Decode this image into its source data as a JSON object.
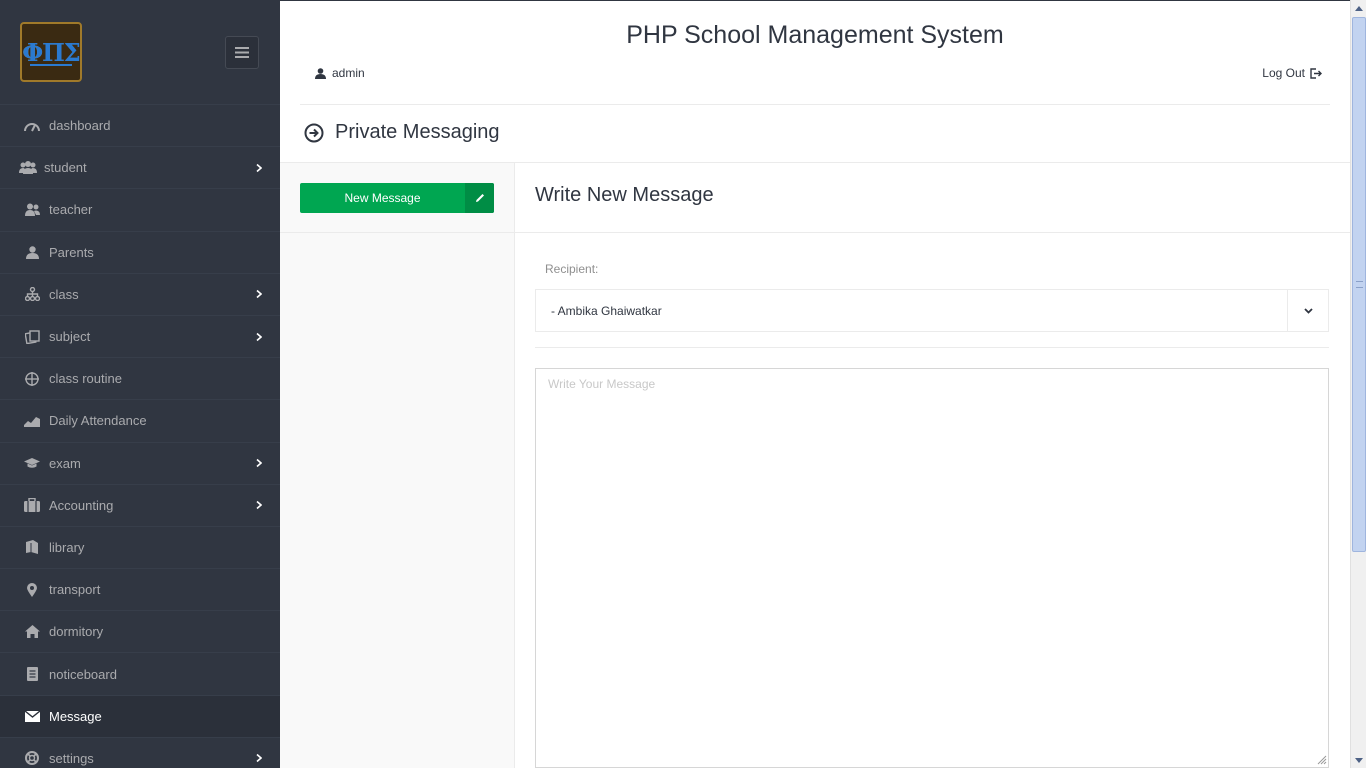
{
  "app": {
    "title": "PHP School Management System",
    "logo_text": "ΦΠΣ",
    "user": "admin",
    "logout_label": "Log Out"
  },
  "sidebar": {
    "items": [
      {
        "label": "dashboard",
        "icon": "gauge-icon",
        "has_submenu": false
      },
      {
        "label": "student",
        "icon": "users-icon",
        "has_submenu": true
      },
      {
        "label": "teacher",
        "icon": "user-pair-icon",
        "has_submenu": false
      },
      {
        "label": "Parents",
        "icon": "user-icon",
        "has_submenu": false
      },
      {
        "label": "class",
        "icon": "flow-tree-icon",
        "has_submenu": true
      },
      {
        "label": "subject",
        "icon": "docs-icon",
        "has_submenu": true
      },
      {
        "label": "class routine",
        "icon": "target-icon",
        "has_submenu": false
      },
      {
        "label": "Daily Attendance",
        "icon": "chart-area-icon",
        "has_submenu": false
      },
      {
        "label": "exam",
        "icon": "graduation-cap-icon",
        "has_submenu": true
      },
      {
        "label": "Accounting",
        "icon": "suitcase-icon",
        "has_submenu": true
      },
      {
        "label": "library",
        "icon": "book-icon",
        "has_submenu": false
      },
      {
        "label": "transport",
        "icon": "location-icon",
        "has_submenu": false
      },
      {
        "label": "dormitory",
        "icon": "home-icon",
        "has_submenu": false
      },
      {
        "label": "noticeboard",
        "icon": "doc-text-icon",
        "has_submenu": false
      },
      {
        "label": "Message",
        "icon": "mail-icon",
        "has_submenu": false,
        "active": true
      },
      {
        "label": "settings",
        "icon": "lifebuoy-icon",
        "has_submenu": true
      }
    ]
  },
  "page": {
    "heading": "Private Messaging"
  },
  "mail": {
    "new_message_label": "New Message",
    "compose_title": "Write New Message",
    "recipient_label": "Recipient:",
    "recipient_value": "- Ambika Ghaiwatkar",
    "message_placeholder": "Write Your Message",
    "message_value": ""
  },
  "colors": {
    "sidebar_bg": "#303641",
    "sidebar_active_bg": "#2b303a",
    "sidebar_text": "#aaabae",
    "accent_green": "#00a651",
    "accent_green_dark": "#008d45"
  }
}
